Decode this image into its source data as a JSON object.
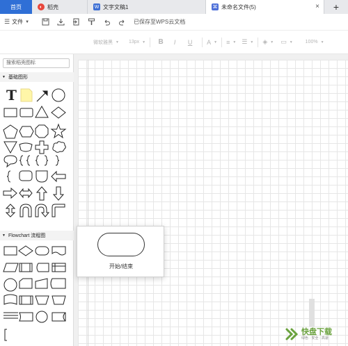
{
  "tabs": {
    "home": "首页",
    "tab_a": "稻壳",
    "tab_b": "文字文稿1",
    "tab_c": "未命名文件(5)",
    "add": "+"
  },
  "toolbar1": {
    "file_label": "文件",
    "saved_status": "已保存至WPS云文档"
  },
  "toolbar2": {
    "font_family": "微软雅黑",
    "font_size": "13px",
    "bold": "B",
    "italic": "I",
    "underline": "U",
    "font_color": "A",
    "zoom": "100%"
  },
  "sidebar": {
    "search_placeholder": "搜索稻壳图标",
    "section_basic": "基础图形",
    "section_flowchart": "Flowchart 流程图"
  },
  "popup": {
    "label": "开始/结束"
  },
  "watermark": {
    "title": "快盘下载",
    "subtitle": "绿色 · 安全 · 高速"
  },
  "colors": {
    "accent": "#2f6fd6",
    "tab_daoke": "#e8473c",
    "tab_doc": "#3d6fd4",
    "tab_flow": "#4d6fd8",
    "watermark_green": "#6aa23d"
  },
  "icons": {
    "menu": "hamburger-icon",
    "save": "save-icon",
    "export": "export-icon",
    "import": "import-icon",
    "format_painter": "format-painter-icon",
    "undo": "undo-icon",
    "redo": "redo-icon"
  }
}
